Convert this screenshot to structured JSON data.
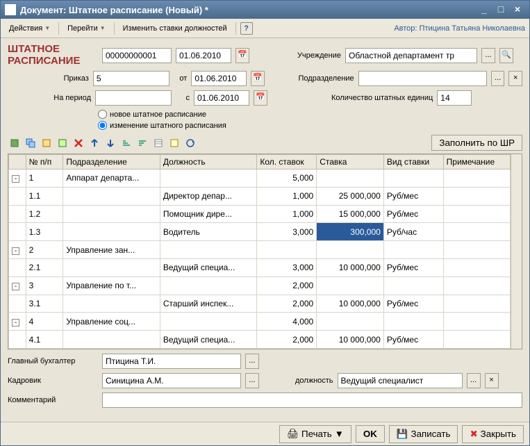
{
  "window": {
    "title": "Документ: Штатное расписание (Новый) *"
  },
  "menu": {
    "actions": "Действия",
    "goto": "Перейти",
    "change_rates": "Изменить ставки должностей",
    "author_label": "Автор:",
    "author_name": "Птицина Татьяна Николаевна"
  },
  "form": {
    "title_line1": "ШТАТНОЕ",
    "title_line2": "РАСПИСАНИЕ",
    "doc_number": "00000000001",
    "doc_date": "01.06.2010",
    "org_label": "Учреждение",
    "org_value": "Областной департамент тр",
    "order_label": "Приказ",
    "order_value": "5",
    "from_label": "от",
    "order_date": "01.06.2010",
    "subdiv_label": "Подразделение",
    "subdiv_value": "",
    "period_label": "На период",
    "period_value": "",
    "s_label": "с",
    "period_date": "01.06.2010",
    "units_label": "Количество штатных единиц",
    "units_value": "14",
    "radio_new": "новое штатное расписание",
    "radio_change": "изменение штатного расписания",
    "fill_btn": "Заполнить по ШР"
  },
  "table": {
    "headers": [
      "№ п/п",
      "Подразделение",
      "Должность",
      "Кол. ставок",
      "Ставка",
      "Вид ставки",
      "Примечание"
    ],
    "rows": [
      {
        "toggle": "-",
        "num": "1",
        "subdiv": "Аппарат департа...",
        "pos": "",
        "count": "5,000",
        "rate": "",
        "kind": "",
        "note": ""
      },
      {
        "toggle": "",
        "num": "1.1",
        "subdiv": "",
        "pos": "Директор депар...",
        "count": "1,000",
        "rate": "25 000,000",
        "kind": "Руб/мес",
        "note": ""
      },
      {
        "toggle": "",
        "num": "1.2",
        "subdiv": "",
        "pos": "Помощник дире...",
        "count": "1,000",
        "rate": "15 000,000",
        "kind": "Руб/мес",
        "note": ""
      },
      {
        "toggle": "",
        "num": "1.3",
        "subdiv": "",
        "pos": "Водитель",
        "count": "3,000",
        "rate": "300,000",
        "kind": "Руб/час",
        "note": "",
        "sel": true
      },
      {
        "toggle": "-",
        "num": "2",
        "subdiv": "Управление зан...",
        "pos": "",
        "count": "",
        "rate": "",
        "kind": "",
        "note": ""
      },
      {
        "toggle": "",
        "num": "2.1",
        "subdiv": "",
        "pos": "Ведущий специа...",
        "count": "3,000",
        "rate": "10 000,000",
        "kind": "Руб/мес",
        "note": ""
      },
      {
        "toggle": "-",
        "num": "3",
        "subdiv": "Управление по т...",
        "pos": "",
        "count": "2,000",
        "rate": "",
        "kind": "",
        "note": ""
      },
      {
        "toggle": "",
        "num": "3.1",
        "subdiv": "",
        "pos": "Старший инспек...",
        "count": "2,000",
        "rate": "10 000,000",
        "kind": "Руб/мес",
        "note": ""
      },
      {
        "toggle": "-",
        "num": "4",
        "subdiv": "Управление соц...",
        "pos": "",
        "count": "4,000",
        "rate": "",
        "kind": "",
        "note": ""
      },
      {
        "toggle": "",
        "num": "4.1",
        "subdiv": "",
        "pos": "Ведущий специа...",
        "count": "2,000",
        "rate": "10 000,000",
        "kind": "Руб/мес",
        "note": ""
      }
    ]
  },
  "footer": {
    "accountant_label": "Главный бухгалтер",
    "accountant_value": "Птицина Т.И.",
    "hr_label": "Кадровик",
    "hr_value": "Синицина А.М.",
    "position_label": "должность",
    "position_value": "Ведущий специалист",
    "comment_label": "Комментарий",
    "comment_value": ""
  },
  "buttons": {
    "print": "Печать",
    "ok": "OK",
    "save": "Записать",
    "close": "Закрыть"
  }
}
